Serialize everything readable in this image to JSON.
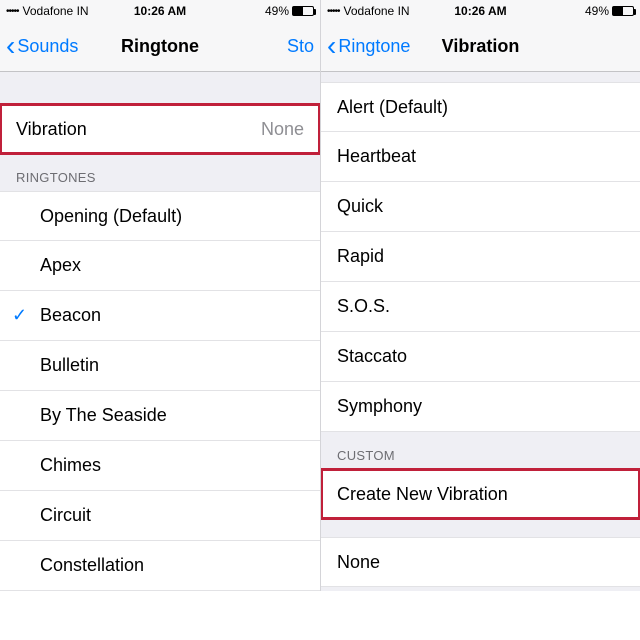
{
  "status": {
    "signal_dots": "•••••",
    "carrier": "Vodafone IN",
    "time": "10:26 AM",
    "battery_pct": "49%"
  },
  "left": {
    "nav": {
      "back": "Sounds",
      "title": "Ringtone",
      "action": "Sto"
    },
    "vibration_label": "Vibration",
    "vibration_value": "None",
    "section_ringtones": "RINGTONES",
    "ringtones": [
      {
        "label": "Opening (Default)"
      },
      {
        "label": "Apex"
      },
      {
        "label": "Beacon",
        "checked": true
      },
      {
        "label": "Bulletin"
      },
      {
        "label": "By The Seaside"
      },
      {
        "label": "Chimes"
      },
      {
        "label": "Circuit"
      },
      {
        "label": "Constellation"
      }
    ]
  },
  "right": {
    "nav": {
      "back": "Ringtone",
      "title": "Vibration"
    },
    "patterns": [
      {
        "label": "Alert (Default)"
      },
      {
        "label": "Heartbeat"
      },
      {
        "label": "Quick"
      },
      {
        "label": "Rapid"
      },
      {
        "label": "S.O.S."
      },
      {
        "label": "Staccato"
      },
      {
        "label": "Symphony"
      }
    ],
    "section_custom": "CUSTOM",
    "create_new": "Create New Vibration",
    "none_label": "None"
  }
}
